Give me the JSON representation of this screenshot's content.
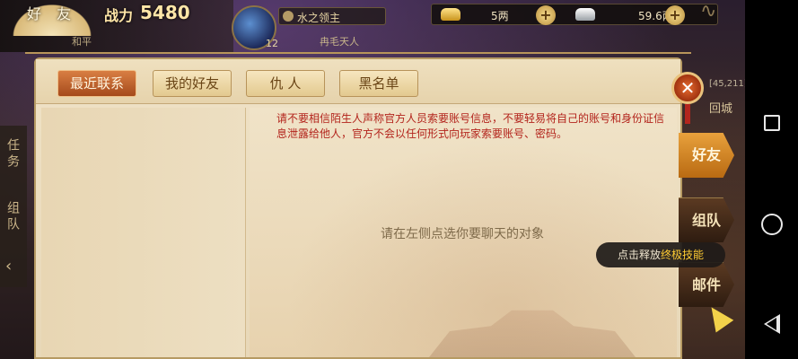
{
  "hud": {
    "panel_title": "好 友",
    "player_sub": "和平",
    "power_label": "战力",
    "power_value": "5480",
    "map_level": "12",
    "location": "水之领主",
    "location_sub": "冉毛天人",
    "gold": "5两",
    "silver": "59.6两",
    "coords": "[45,211]",
    "return_city": "回城"
  },
  "side_left": {
    "tab1": "任务",
    "tab2": "组队"
  },
  "tabs": [
    {
      "label": "最近联系",
      "active": true
    },
    {
      "label": "我的好友",
      "active": false
    },
    {
      "label": "仇 人",
      "active": false
    },
    {
      "label": "黑名单",
      "active": false
    }
  ],
  "chat": {
    "warning": "请不要相信陌生人声称官方人员索要账号信息，不要轻易将自己的账号和身份证信息泄露给他人，官方不会以任何形式向玩家索要账号、密码。",
    "placeholder": "请在左侧点选你要聊天的对象"
  },
  "right_nav": {
    "friends": "好友",
    "team": "组队",
    "mail": "邮件"
  },
  "tooltip": {
    "prefix": "点击释放",
    "highlight": "终极技能"
  },
  "close_symbol": "✕",
  "plus_symbol": "+"
}
